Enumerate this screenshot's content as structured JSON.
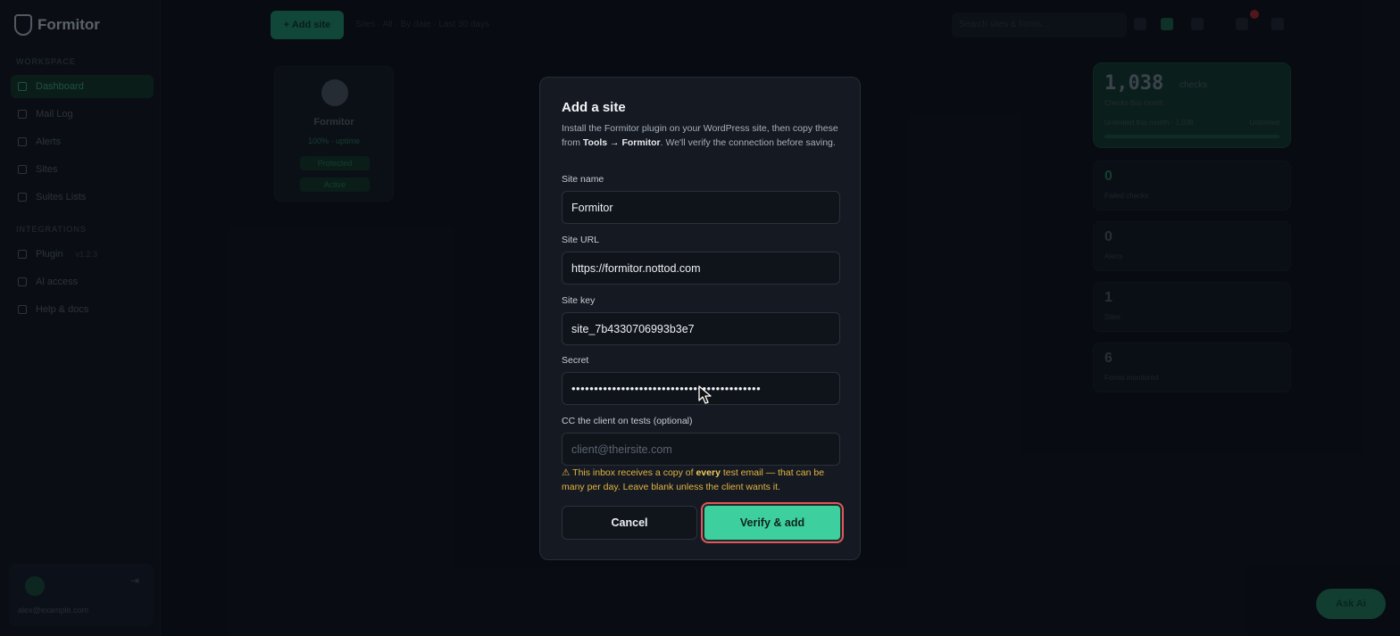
{
  "app": {
    "name": "Formitor",
    "nav_sections": [
      "WORKSPACE",
      "INTEGRATIONS"
    ],
    "nav_items": [
      {
        "label": "Dashboard",
        "badge": ""
      },
      {
        "label": "Mail Log",
        "badge": ""
      },
      {
        "label": "Alerts",
        "badge": ""
      },
      {
        "label": "Sites",
        "badge": ""
      },
      {
        "label": "Suites Lists",
        "badge": ""
      },
      {
        "label": "Plugin",
        "badge": "v1.2.3"
      },
      {
        "label": "Al access",
        "badge": ""
      },
      {
        "label": "Help & docs",
        "badge": ""
      }
    ],
    "user_email": "alex@example.com",
    "add_site_button": "+ Add site",
    "breadcrumb": "Sites · All · By date · Last 30 days",
    "search_placeholder": "Search sites & forms…",
    "help_button": "Ask Ai"
  },
  "site_card": {
    "name": "Formitor",
    "uptime": "100% · uptime",
    "pill_1": "Protected",
    "pill_2": "Active"
  },
  "stats": {
    "hero_value": "1,038",
    "hero_unit": "checks",
    "hero_sub": "Checks this month",
    "hero_meta_left": "Unlimited this month · 1,038",
    "hero_meta_right": "Unlimited",
    "cards": [
      {
        "value": "0",
        "label": "Failed checks"
      },
      {
        "value": "0",
        "label": "Alerts"
      },
      {
        "value": "1",
        "label": "Sites"
      },
      {
        "value": "6",
        "label": "Forms monitored"
      }
    ]
  },
  "modal": {
    "title": "Add a site",
    "desc_prefix": "Install the Formitor plugin on your WordPress site, then copy these from ",
    "desc_bold": "Tools → Formitor",
    "desc_suffix": ". We'll verify the connection before saving.",
    "fields": {
      "site_name": {
        "label": "Site name",
        "value": "Formitor"
      },
      "site_url": {
        "label": "Site URL",
        "value": "https://formitor.nottod.com"
      },
      "site_key": {
        "label": "Site key",
        "value": "site_7b4330706993b3e7"
      },
      "secret": {
        "label": "Secret",
        "value": "••••••••••••••••••••••••••••••••••••••••••"
      },
      "cc_email": {
        "label": "CC the client on tests (optional)",
        "placeholder": "client@theirsite.com"
      }
    },
    "warning_icon": "⚠",
    "warning_prefix": " This inbox receives a copy of ",
    "warning_bold": "every",
    "warning_suffix": " test email — that can be many per day. Leave blank unless the client wants it.",
    "cancel_label": "Cancel",
    "verify_label": "Verify & add"
  },
  "colors": {
    "accent": "#3ecf9e",
    "focus_ring": "#e0555f",
    "warning": "#e3b341"
  }
}
